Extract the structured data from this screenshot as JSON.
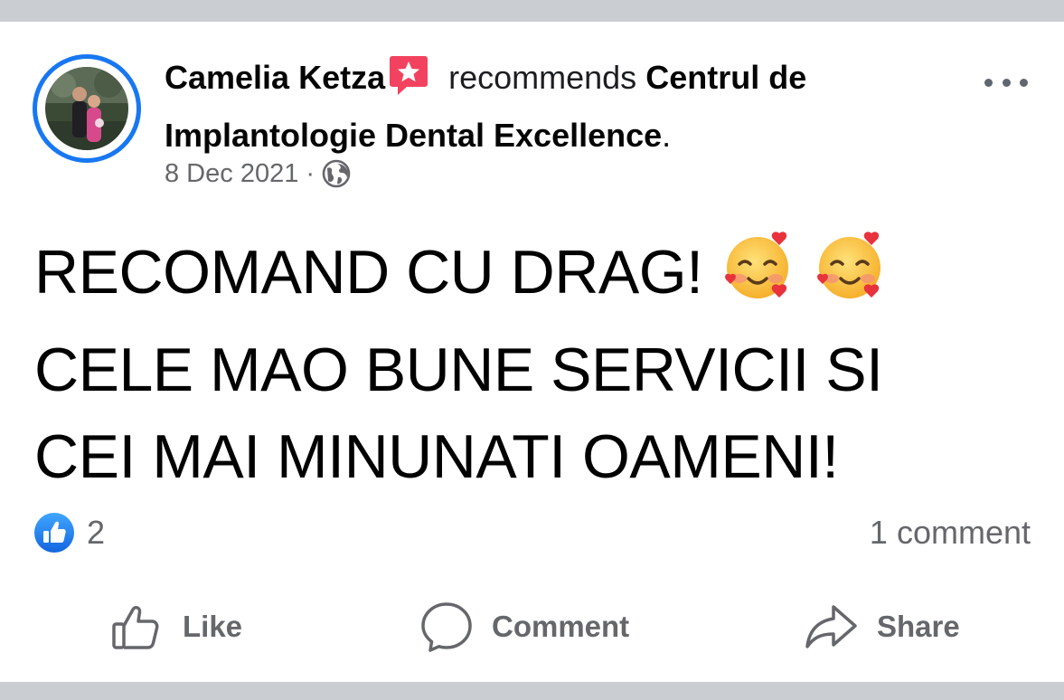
{
  "post": {
    "author": "Camelia Ketza",
    "recommends_word": "recommends",
    "page_name": "Centrul de Implantologie Dental Excellence",
    "page_period": ".",
    "date": "8 Dec 2021",
    "separator": "·",
    "privacy_icon": "globe-icon",
    "lines": [
      "RECOMAND CU DRAG!",
      "CELE MAO BUNE SERVICII SI",
      "CEI MAI MINUNATI OAMENI!"
    ],
    "emojis": [
      "smiling-face-with-hearts",
      "smiling-face-with-hearts"
    ]
  },
  "reactions": {
    "icon": "like-reaction-icon",
    "count": "2",
    "comments_label": "1 comment"
  },
  "actions": {
    "like": "Like",
    "comment": "Comment",
    "share": "Share"
  },
  "colors": {
    "accent": "#1877f2",
    "recommend_badge": "#f3425f",
    "muted_text": "#65676b",
    "divider_bar": "#cacdd2"
  }
}
